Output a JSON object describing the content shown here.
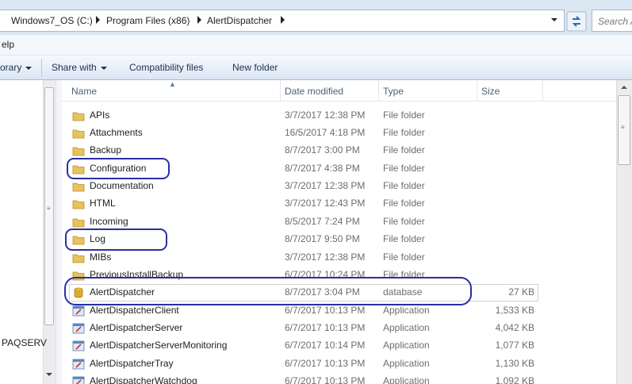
{
  "address_bar": {
    "crumbs": [
      "Windows7_OS (C:)",
      "Program Files (x86)",
      "AlertDispatcher"
    ],
    "search_placeholder": "Search A"
  },
  "menu": {
    "help_label": "elp"
  },
  "toolbar": {
    "library_label": "orary",
    "share_label": "Share with",
    "compat_label": "Compatibility files",
    "newfolder_label": "New folder"
  },
  "nav": {
    "item_label": "PAQSERV"
  },
  "columns": {
    "name": "Name",
    "date": "Date modified",
    "type": "Type",
    "size": "Size"
  },
  "files": [
    {
      "name": "APIs",
      "date": "3/7/2017 12:38 PM",
      "type": "File folder",
      "size": "",
      "icon": "folder-icon"
    },
    {
      "name": "Attachments",
      "date": "16/5/2017 4:18 PM",
      "type": "File folder",
      "size": "",
      "icon": "folder-icon"
    },
    {
      "name": "Backup",
      "date": "8/7/2017 3:00 PM",
      "type": "File folder",
      "size": "",
      "icon": "folder-icon"
    },
    {
      "name": "Configuration",
      "date": "8/7/2017 4:38 PM",
      "type": "File folder",
      "size": "",
      "icon": "folder-icon"
    },
    {
      "name": "Documentation",
      "date": "3/7/2017 12:38 PM",
      "type": "File folder",
      "size": "",
      "icon": "folder-icon"
    },
    {
      "name": "HTML",
      "date": "3/7/2017 12:43 PM",
      "type": "File folder",
      "size": "",
      "icon": "folder-icon"
    },
    {
      "name": "Incoming",
      "date": "8/5/2017 7:24 PM",
      "type": "File folder",
      "size": "",
      "icon": "folder-icon"
    },
    {
      "name": "Log",
      "date": "8/7/2017 9:50 PM",
      "type": "File folder",
      "size": "",
      "icon": "folder-icon"
    },
    {
      "name": "MIBs",
      "date": "3/7/2017 12:38 PM",
      "type": "File folder",
      "size": "",
      "icon": "folder-icon"
    },
    {
      "name": "PreviousInstallBackup",
      "date": "6/7/2017 10:24 PM",
      "type": "File folder",
      "size": "",
      "icon": "folder-icon"
    },
    {
      "name": "AlertDispatcher",
      "date": "8/7/2017 3:04 PM",
      "type": "database",
      "size": "27 KB",
      "icon": "database-icon"
    },
    {
      "name": "AlertDispatcherClient",
      "date": "6/7/2017 10:13 PM",
      "type": "Application",
      "size": "1,533 KB",
      "icon": "application-icon"
    },
    {
      "name": "AlertDispatcherServer",
      "date": "6/7/2017 10:13 PM",
      "type": "Application",
      "size": "4,042 KB",
      "icon": "application-icon"
    },
    {
      "name": "AlertDispatcherServerMonitoring",
      "date": "6/7/2017 10:14 PM",
      "type": "Application",
      "size": "1,077 KB",
      "icon": "application-icon"
    },
    {
      "name": "AlertDispatcherTray",
      "date": "6/7/2017 10:13 PM",
      "type": "Application",
      "size": "1,130 KB",
      "icon": "application-icon"
    },
    {
      "name": "AlertDispatcherWatchdog",
      "date": "6/7/2017 10:13 PM",
      "type": "Application",
      "size": "1,092 KB",
      "icon": "application-icon"
    }
  ],
  "colors": {
    "annotation": "#2b2fa0",
    "folder": "#e8c25a",
    "header_text": "#4c607a",
    "toolbar_text": "#1e3050"
  }
}
